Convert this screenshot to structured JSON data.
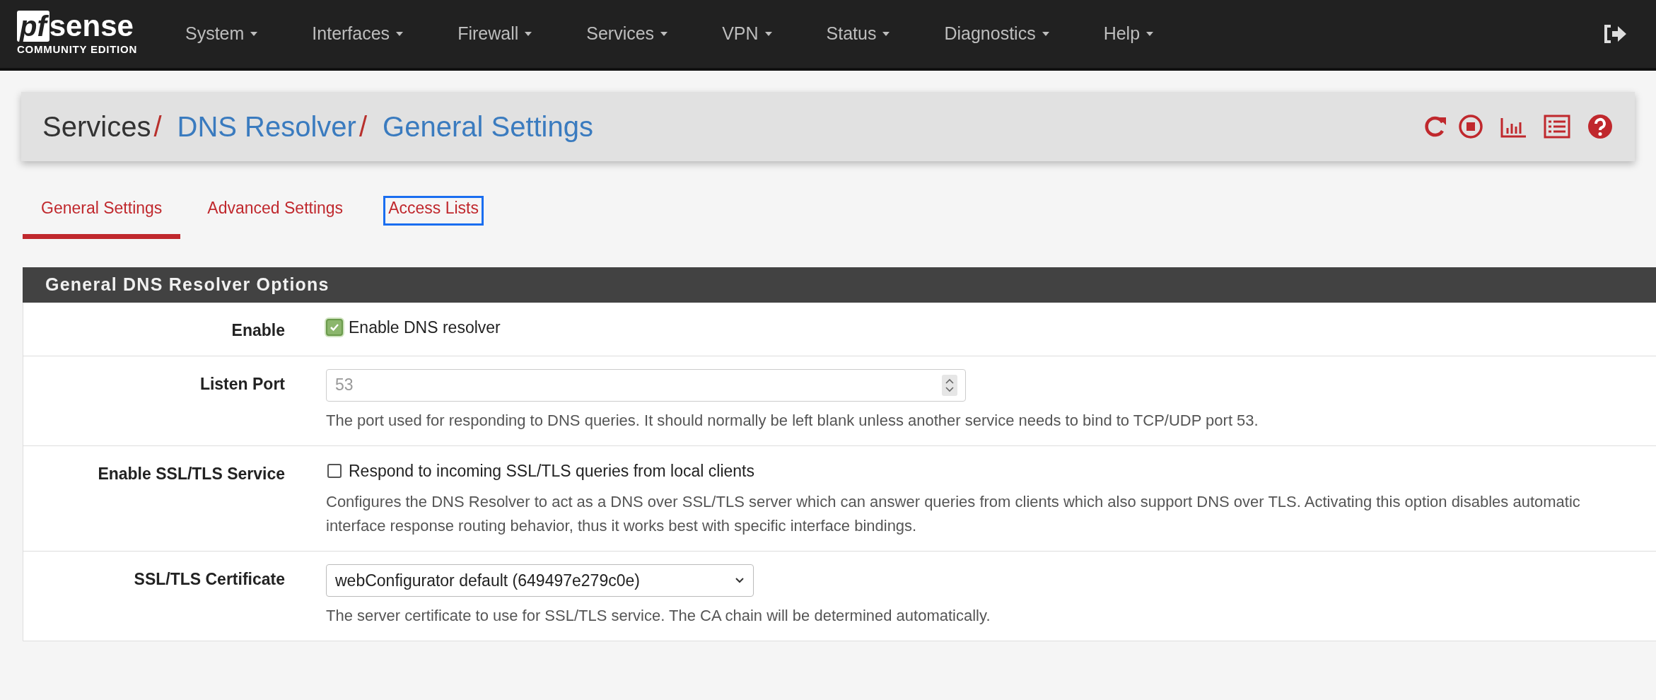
{
  "logo": {
    "mark": "pf",
    "word": "sense",
    "edition": "COMMUNITY EDITION"
  },
  "nav": [
    {
      "label": "System"
    },
    {
      "label": "Interfaces"
    },
    {
      "label": "Firewall"
    },
    {
      "label": "Services"
    },
    {
      "label": "VPN"
    },
    {
      "label": "Status"
    },
    {
      "label": "Diagnostics"
    },
    {
      "label": "Help"
    }
  ],
  "breadcrumb": [
    {
      "label": "Services",
      "link": false
    },
    {
      "separator": "/",
      "label": "DNS Resolver",
      "link": true
    },
    {
      "separator": "/",
      "label": "General Settings",
      "link": true
    }
  ],
  "tabs": [
    {
      "label": "General Settings",
      "selected": true,
      "focused": false
    },
    {
      "label": "Advanced Settings",
      "selected": false,
      "focused": false
    },
    {
      "label": "Access Lists",
      "selected": false,
      "focused": true
    }
  ],
  "panel": {
    "title": "General DNS Resolver Options",
    "rows": [
      {
        "kind": "checkbox",
        "label": "Enable",
        "text": "Enable DNS resolver",
        "checked": true
      },
      {
        "kind": "number",
        "label": "Listen Port",
        "placeholder": "53",
        "help": "The port used for responding to DNS queries. It should normally be left blank unless another service needs to bind to TCP/UDP port 53."
      },
      {
        "kind": "checkbox",
        "label": "Enable SSL/TLS Service",
        "text": "Respond to incoming SSL/TLS queries from local clients",
        "checked": false,
        "help": "Configures the DNS Resolver to act as a DNS over SSL/TLS server which can answer queries from clients which also support DNS over TLS. Activating this option disables automatic interface response routing behavior, thus it works best with specific interface bindings."
      },
      {
        "kind": "select",
        "label": "SSL/TLS Certificate",
        "value": "webConfigurator default (649497e279c0e)",
        "help": "The server certificate to use for SSL/TLS service. The CA chain will be determined automatically."
      }
    ]
  }
}
